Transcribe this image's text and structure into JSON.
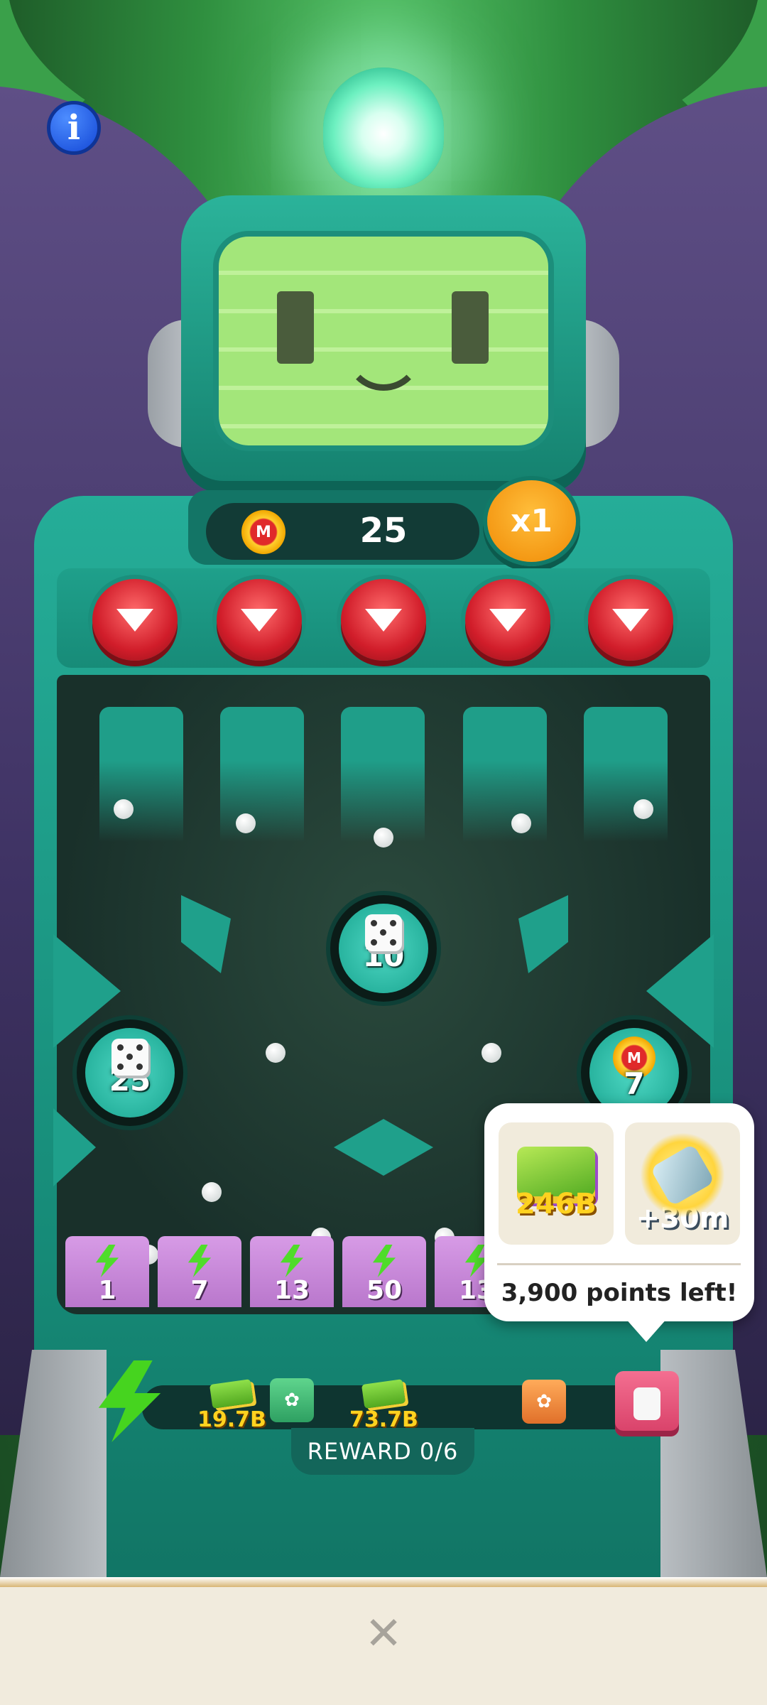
{
  "game": {
    "score": "25",
    "multiplier": "x1",
    "info_icon": "info-icon",
    "coin_icon": "monopoly-coin-icon",
    "coin_letter": "M"
  },
  "bumpers": [
    {
      "value": "10",
      "type": "dice"
    },
    {
      "value": "25",
      "type": "dice"
    },
    {
      "value": "7",
      "type": "coin"
    }
  ],
  "slots": [
    "1",
    "7",
    "13",
    "50",
    "13"
  ],
  "progress": {
    "rewards": [
      {
        "value": "19.7B",
        "type": "cash"
      },
      {
        "value": "",
        "type": "green-sticker-pack"
      },
      {
        "value": "73.7B",
        "type": "cash"
      },
      {
        "value": "",
        "type": "orange-sticker-pack"
      },
      {
        "value": "",
        "type": "safe"
      }
    ],
    "label": "REWARD 0/6"
  },
  "tooltip": {
    "items": [
      {
        "value": "246B",
        "type": "cash"
      },
      {
        "value": "+30m",
        "type": "hammer"
      }
    ],
    "text": "3,900 points left!"
  },
  "bottom": {
    "close_icon": "close-icon",
    "close_glyph": "✕"
  },
  "colors": {
    "machine": "#1fa08b",
    "drop_button": "#d11d2a",
    "slot": "#c88ad9",
    "multiplier": "#f5a014",
    "reward_text": "#ffd21f"
  }
}
